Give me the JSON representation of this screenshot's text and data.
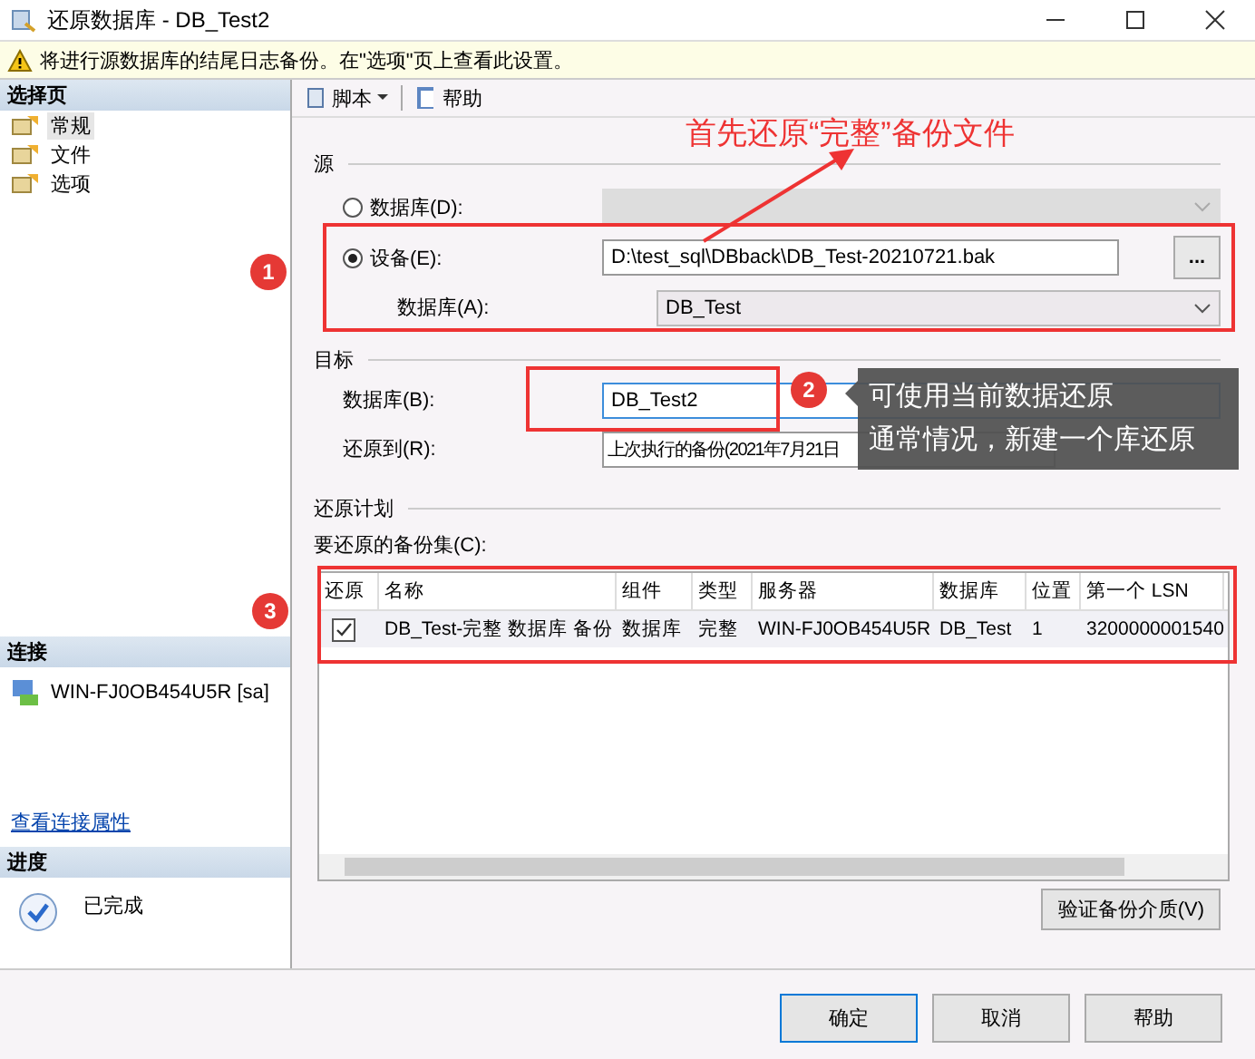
{
  "window": {
    "title": "还原数据库 - DB_Test2"
  },
  "warning": "将进行源数据库的结尾日志备份。在\"选项\"页上查看此设置。",
  "sidebar": {
    "header": "选择页",
    "items": [
      {
        "label": "常规",
        "selected": true
      },
      {
        "label": "文件",
        "selected": false
      },
      {
        "label": "选项",
        "selected": false
      }
    ]
  },
  "connection": {
    "header": "连接",
    "server": "WIN-FJ0OB454U5R [sa]",
    "link": "查看连接属性"
  },
  "progress": {
    "header": "进度",
    "status": "已完成"
  },
  "toolbar": [
    {
      "kind": "dropdown",
      "label": "脚本"
    },
    {
      "kind": "button",
      "label": "帮助"
    }
  ],
  "source": {
    "title": "源",
    "options": [
      {
        "label": "数据库(D):",
        "selected": false
      },
      {
        "label": "设备(E):",
        "selected": true
      }
    ],
    "device_path": "D:\\test_sql\\DBback\\DB_Test-20210721.bak",
    "browse": "...",
    "database_label": "数据库(A):",
    "database_value": "DB_Test"
  },
  "destination": {
    "title": "目标",
    "database_label": "数据库(B):",
    "database_value": "DB_Test2",
    "restore_to_label": "还原到(R):",
    "restore_to_value": "上次执行的备份(2021年7月21日"
  },
  "plan": {
    "title": "还原计划",
    "table_label": "要还原的备份集(C):",
    "columns": [
      "还原",
      "名称",
      "组件",
      "类型",
      "服务器",
      "数据库",
      "位置",
      "第一个 LSN"
    ],
    "rows": [
      {
        "checked": true,
        "cells": [
          "",
          "DB_Test-完整 数据库 备份",
          "数据库",
          "完整",
          "WIN-FJ0OB454U5R",
          "DB_Test",
          "1",
          "3200000001540"
        ]
      }
    ]
  },
  "verify_button": "验证备份介质(V)",
  "buttons": [
    "确定",
    "取消",
    "帮助"
  ],
  "annotations": {
    "heading": "首先还原“完整”备份文件",
    "callouts": [
      "1",
      "2",
      "3"
    ],
    "tooltip": [
      "可使用当前数据还原",
      "通常情况，新建一个库还原"
    ]
  }
}
